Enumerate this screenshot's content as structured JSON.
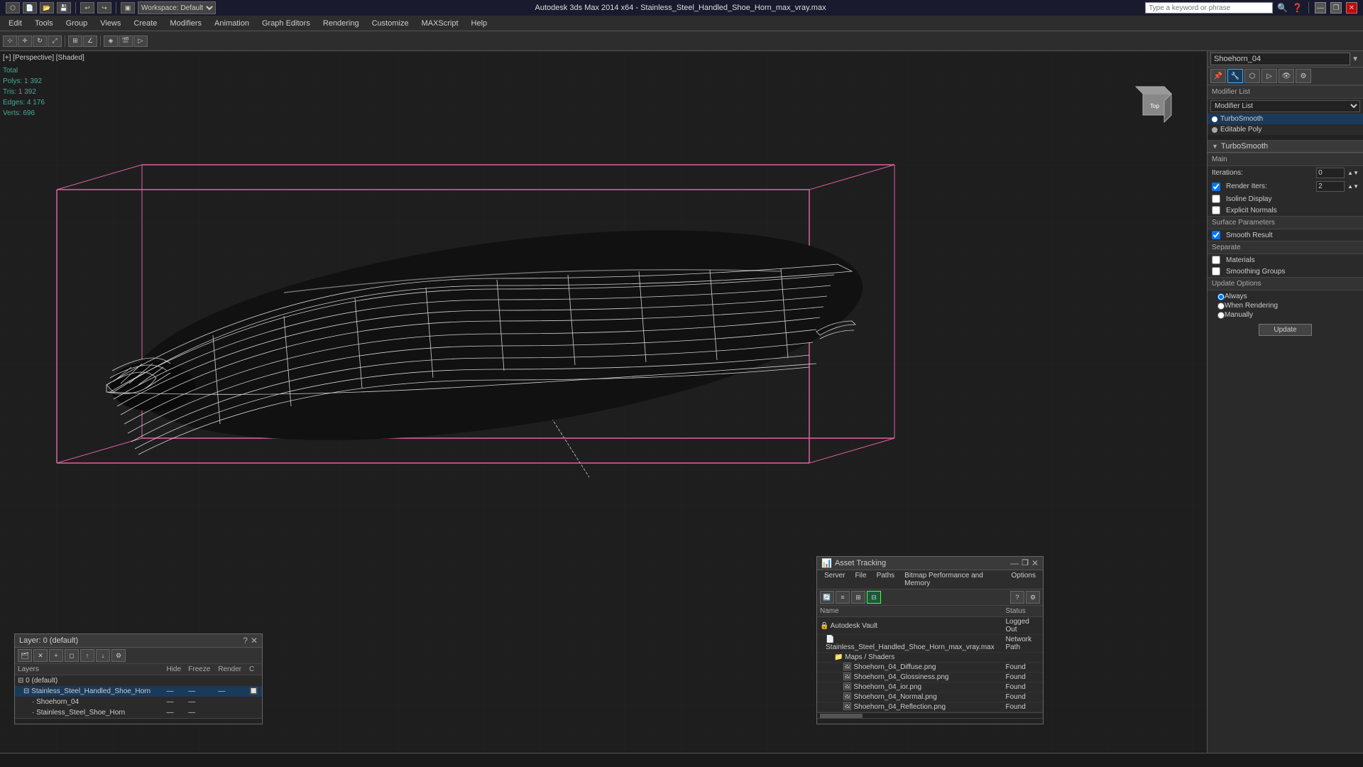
{
  "titlebar": {
    "app_icon": "3dsmax-icon",
    "toolbar_items": [
      "new",
      "open",
      "save"
    ],
    "workspace_label": "Workspace: Default",
    "title": "Autodesk 3ds Max 2014 x64 - Stainless_Steel_Handled_Shoe_Horn_max_vray.max",
    "search_placeholder": "Type a keyword or phrase",
    "search_or_phrase": "Or phrase",
    "minimize_label": "—",
    "restore_label": "❐",
    "close_label": "✕"
  },
  "menubar": {
    "items": [
      "Edit",
      "Tools",
      "Group",
      "Views",
      "Create",
      "Modifiers",
      "Animation",
      "Graph Editors",
      "Rendering",
      "Customize",
      "MAXScript",
      "Help"
    ]
  },
  "viewport": {
    "label": "[+] [Perspective] [Shaded]",
    "stats": {
      "polys_label": "Polys:",
      "polys_value": "1 392",
      "tris_label": "Tris:",
      "tris_value": "1 392",
      "edges_label": "Edges:",
      "edges_value": "4 176",
      "verts_label": "Verts:",
      "verts_value": "696",
      "total_label": "Total"
    }
  },
  "right_panel": {
    "object_name": "Shoehorn_04",
    "modifier_list_label": "Modifier List",
    "modifiers": [
      {
        "name": "TurboSmooth",
        "dot": "white"
      },
      {
        "name": "Editable Poly",
        "dot": "light"
      }
    ],
    "icons": [
      "pin",
      "modifier",
      "hierarchy",
      "motion",
      "display",
      "utilities"
    ],
    "turbosmooth": {
      "title": "TurboSmooth",
      "main_section": "Main",
      "iterations_label": "Iterations:",
      "iterations_value": "0",
      "render_iters_label": "Render Iters:",
      "render_iters_value": "2",
      "render_iters_checked": true,
      "isoline_display_label": "Isoline Display",
      "isoline_checked": false,
      "explicit_normals_label": "Explicit Normals",
      "explicit_checked": false,
      "surface_params_label": "Surface Parameters",
      "smooth_result_label": "Smooth Result",
      "smooth_result_checked": true,
      "separate_label": "Separate",
      "materials_label": "Materials",
      "materials_checked": false,
      "smoothing_groups_label": "Smoothing Groups",
      "smoothing_checked": false,
      "update_options_label": "Update Options",
      "always_label": "Always",
      "always_selected": true,
      "when_rendering_label": "When Rendering",
      "when_rendering_selected": false,
      "manually_label": "Manually",
      "manually_selected": false,
      "update_btn_label": "Update"
    }
  },
  "layers_panel": {
    "title": "Layer: 0 (default)",
    "columns": [
      "Layers",
      "Hide",
      "Freeze",
      "Render",
      "C"
    ],
    "rows": [
      {
        "name": "0 (default)",
        "indent": 0,
        "active": false,
        "hide": "",
        "freeze": "",
        "render": "",
        "c": ""
      },
      {
        "name": "Stainless_Steel_Handled_Shoe_Horn",
        "indent": 1,
        "active": true,
        "hide": "—",
        "freeze": "—",
        "render": "—",
        "c": "—"
      },
      {
        "name": "Shoehorn_04",
        "indent": 2,
        "active": false,
        "hide": "—",
        "freeze": "—",
        "render": "",
        "c": ""
      },
      {
        "name": "Stainless_Steel_Shoe_Horn",
        "indent": 2,
        "active": false,
        "hide": "—",
        "freeze": "—",
        "render": "",
        "c": ""
      }
    ]
  },
  "asset_panel": {
    "title": "Asset Tracking",
    "menu_items": [
      "Server",
      "File",
      "Paths",
      "Bitmap Performance and Memory",
      "Options"
    ],
    "columns": [
      "Name",
      "Status"
    ],
    "rows": [
      {
        "name": "Autodesk Vault",
        "indent": 0,
        "icon": "vault",
        "status": "Logged Out",
        "status_class": "status-logged-out"
      },
      {
        "name": "Stainless_Steel_Handled_Shoe_Horn_max_vray.max",
        "indent": 1,
        "icon": "file",
        "status": "Network Path",
        "status_class": "status-network"
      },
      {
        "name": "Maps / Shaders",
        "indent": 2,
        "icon": "folder",
        "status": "",
        "status_class": ""
      },
      {
        "name": "Shoehorn_04_Diffuse.png",
        "indent": 3,
        "icon": "image",
        "status": "Found",
        "status_class": "status-found"
      },
      {
        "name": "Shoehorn_04_Glossiness.png",
        "indent": 3,
        "icon": "image",
        "status": "Found",
        "status_class": "status-found"
      },
      {
        "name": "Shoehorn_04_ior.png",
        "indent": 3,
        "icon": "image",
        "status": "Found",
        "status_class": "status-found"
      },
      {
        "name": "Shoehorn_04_Normal.png",
        "indent": 3,
        "icon": "image",
        "status": "Found",
        "status_class": "status-found"
      },
      {
        "name": "Shoehorn_04_Reflection.png",
        "indent": 3,
        "icon": "image",
        "status": "Found",
        "status_class": "status-found"
      }
    ]
  },
  "statusbar": {
    "text": ""
  }
}
